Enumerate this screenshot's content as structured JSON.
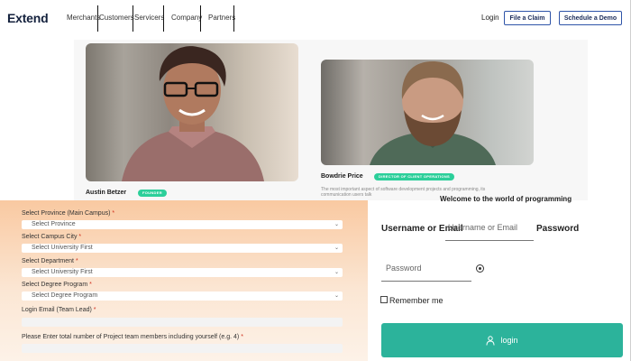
{
  "header": {
    "logo": "Extend",
    "nav": [
      "Merchants",
      "Customers",
      "Servicers",
      "Company",
      "Partners"
    ],
    "login": "Login",
    "file_claim": "File a Claim",
    "schedule_demo": "Schedule a Demo"
  },
  "team": {
    "members": [
      {
        "name": "Austin Betzer",
        "role": "FOUNDER"
      },
      {
        "name": "Bowdrie Price",
        "role": "DIRECTOR OF CLIENT OPERATIONS"
      }
    ],
    "bio": "The most important aspect of software development projects and programming, its communication users talk"
  },
  "registration": {
    "province_label": "Select Province (Main Campus)",
    "province_value": "Select Province",
    "city_label": "Select Campus City",
    "city_value": "Select University First",
    "department_label": "Select Department",
    "department_value": "Select University First",
    "degree_label": "Select Degree Program",
    "degree_value": "Select Degree Program",
    "email_label": "Login Email (Team Lead)",
    "members_label": "Please Enter total number of Project team members including yourself (e.g. 4)",
    "required_mark": "*"
  },
  "login": {
    "welcome": "Welcome to the world of programming",
    "username_label": "Username or Email",
    "username_placeholder": "Username or Email",
    "password_label": "Password",
    "password_placeholder": "Password",
    "remember": "Remember me",
    "submit": "login",
    "accent": "#2cb39b"
  }
}
